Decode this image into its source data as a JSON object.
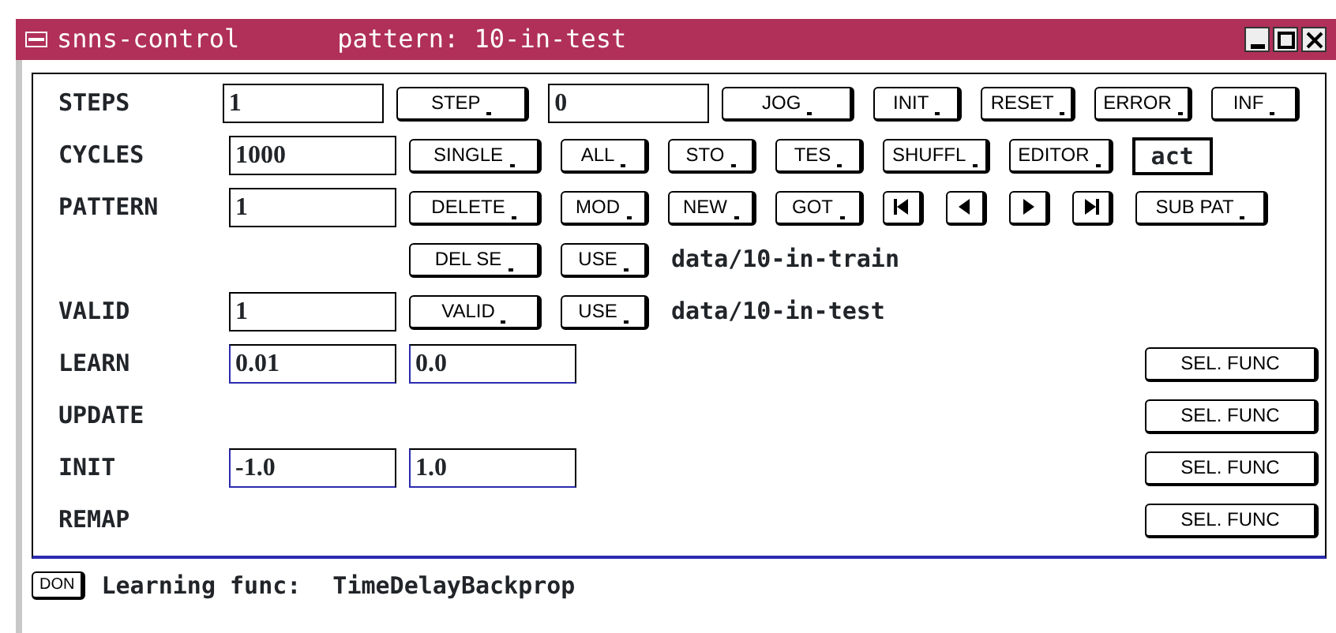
{
  "window": {
    "title": "snns-control",
    "subtitle": "pattern: 10-in-test"
  },
  "rows": [
    {
      "label": "STEPS",
      "items": [
        {
          "kind": "field",
          "value": "1"
        },
        {
          "kind": "button",
          "label": "STEP"
        },
        {
          "kind": "field",
          "value": "0"
        },
        {
          "kind": "button",
          "label": "JOG"
        },
        {
          "kind": "button",
          "label": "INIT"
        },
        {
          "kind": "button",
          "label": "RESET"
        },
        {
          "kind": "button",
          "label": "ERROR"
        },
        {
          "kind": "button",
          "label": "INF"
        }
      ]
    },
    {
      "label": "CYCLES",
      "items": [
        {
          "kind": "field",
          "value": "1000"
        },
        {
          "kind": "button",
          "label": "SINGLE"
        },
        {
          "kind": "button",
          "label": "ALL"
        },
        {
          "kind": "button",
          "label": "STO"
        },
        {
          "kind": "button",
          "label": "TES"
        },
        {
          "kind": "button",
          "label": "SHUFFL"
        },
        {
          "kind": "button",
          "label": "EDITOR"
        },
        {
          "kind": "display",
          "value": "act"
        }
      ]
    },
    {
      "label": "PATTERN",
      "items": [
        {
          "kind": "field",
          "value": "1"
        },
        {
          "kind": "button",
          "label": "DELETE"
        },
        {
          "kind": "button",
          "label": "MOD"
        },
        {
          "kind": "button",
          "label": "NEW"
        },
        {
          "kind": "button",
          "label": "GOT"
        },
        {
          "kind": "nav"
        },
        {
          "kind": "nav"
        },
        {
          "kind": "nav"
        },
        {
          "kind": "nav"
        },
        {
          "kind": "button",
          "label": "SUB PAT"
        }
      ]
    },
    {
      "items": [
        {
          "kind": "button",
          "label": "DEL SE"
        },
        {
          "kind": "button",
          "label": "USE"
        },
        {
          "kind": "text",
          "value": "data/10-in-train"
        }
      ]
    },
    {
      "label": "VALID",
      "items": [
        {
          "kind": "field",
          "value": "1"
        },
        {
          "kind": "button",
          "label": "VALID"
        },
        {
          "kind": "button",
          "label": "USE"
        },
        {
          "kind": "text",
          "value": "data/10-in-test"
        }
      ]
    },
    {
      "label": "LEARN",
      "items": [
        {
          "kind": "field",
          "value": "0.01"
        },
        {
          "kind": "field",
          "value": "0.0"
        },
        {
          "kind": "func",
          "label": "SEL. FUNC"
        }
      ]
    },
    {
      "label": "UPDATE",
      "items": [
        {
          "kind": "func",
          "label": "SEL. FUNC"
        }
      ]
    },
    {
      "label": "INIT",
      "items": [
        {
          "kind": "field",
          "value": "-1.0"
        },
        {
          "kind": "field",
          "value": "1.0"
        },
        {
          "kind": "func",
          "label": "SEL. FUNC"
        }
      ]
    },
    {
      "label": "REMAP",
      "items": [
        {
          "kind": "func",
          "label": "SEL. FUNC"
        }
      ]
    }
  ],
  "status": {
    "button": "DON",
    "label": "Learning func:",
    "value": "TimeDelayBackprop"
  }
}
